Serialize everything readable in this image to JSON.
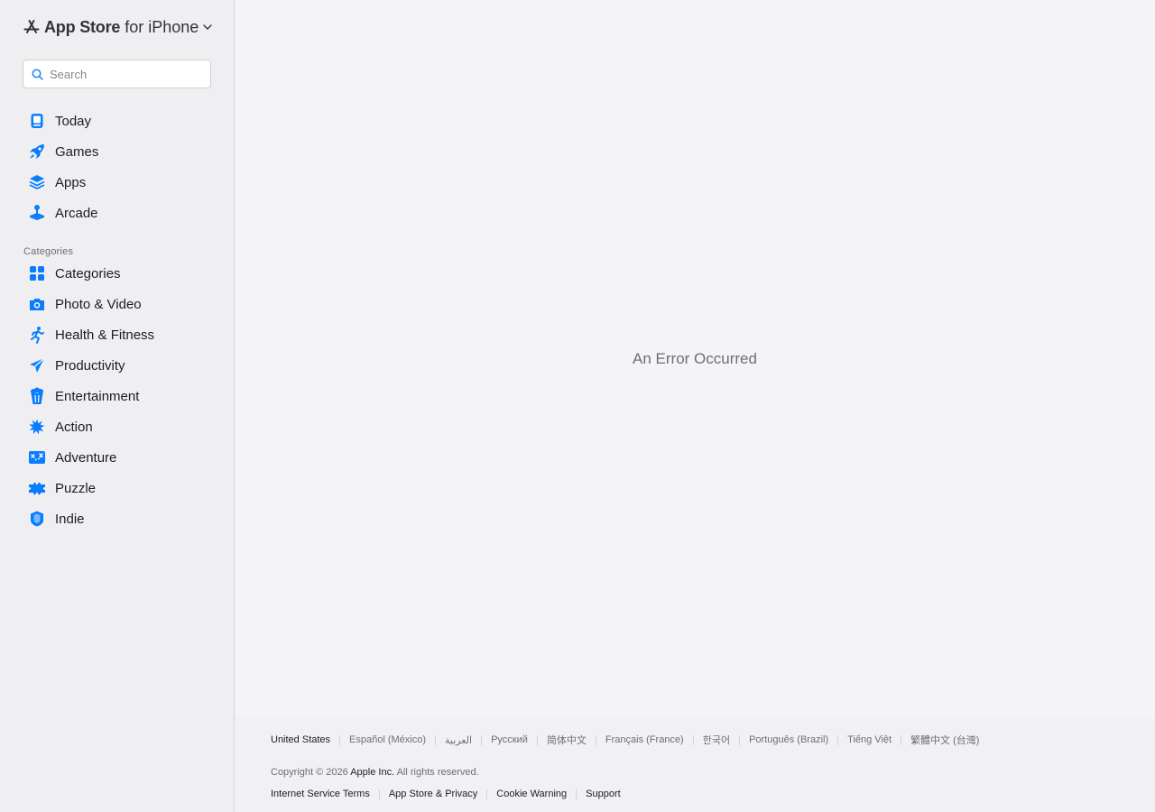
{
  "header": {
    "brand": "App Store",
    "platform": "for iPhone"
  },
  "search": {
    "placeholder": "Search",
    "value": ""
  },
  "nav": {
    "primary": [
      {
        "label": "Today",
        "icon": "today-icon"
      },
      {
        "label": "Games",
        "icon": "rocket-icon"
      },
      {
        "label": "Apps",
        "icon": "layers-icon"
      },
      {
        "label": "Arcade",
        "icon": "joystick-icon"
      }
    ],
    "categories_heading": "Categories",
    "categories": [
      {
        "label": "Categories",
        "icon": "grid-icon"
      },
      {
        "label": "Photo & Video",
        "icon": "camera-icon"
      },
      {
        "label": "Health & Fitness",
        "icon": "running-figure-icon"
      },
      {
        "label": "Productivity",
        "icon": "paper-plane-icon"
      },
      {
        "label": "Entertainment",
        "icon": "popcorn-icon"
      },
      {
        "label": "Action",
        "icon": "burst-icon"
      },
      {
        "label": "Adventure",
        "icon": "map-icon"
      },
      {
        "label": "Puzzle",
        "icon": "puzzle-piece-icon"
      },
      {
        "label": "Indie",
        "icon": "shield-icon"
      }
    ]
  },
  "main": {
    "error_message": "An Error Occurred"
  },
  "footer": {
    "languages": [
      "United States",
      "Español (México)",
      "العربية",
      "Русский",
      "简体中文",
      "Français (France)",
      "한국어",
      "Português (Brazil)",
      "Tiếng Việt",
      "繁體中文 (台灣)"
    ],
    "copyright_prefix": "Copyright © 2026",
    "copyright_company": "Apple Inc.",
    "copyright_suffix": "All rights reserved.",
    "legal_links": [
      "Internet Service Terms",
      "App Store & Privacy",
      "Cookie Warning",
      "Support"
    ]
  },
  "colors": {
    "accent": "#0a7cff",
    "sidebar_bg": "#efeff1",
    "main_bg": "#f4f4f6"
  }
}
